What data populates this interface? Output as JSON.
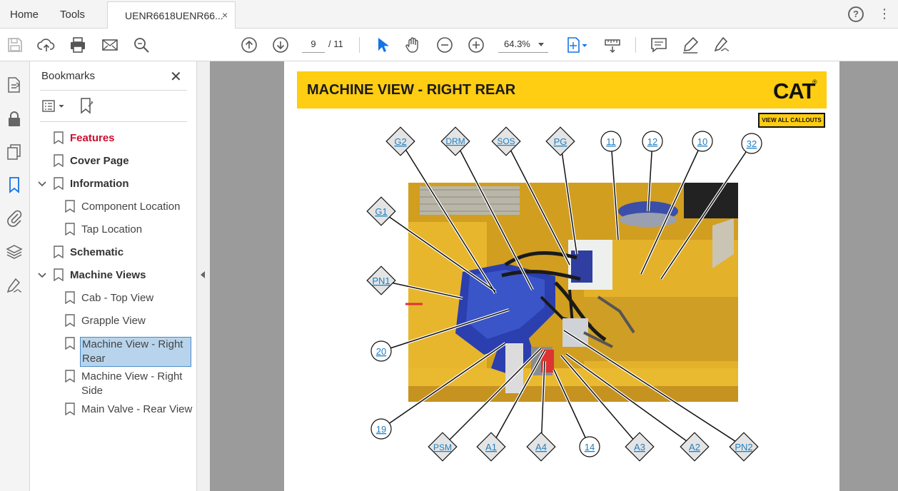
{
  "menubar": {
    "home": "Home",
    "tools": "Tools",
    "tab_title": "UENR6618UENR66...",
    "tab_close": "×",
    "help": "?"
  },
  "toolbar": {
    "page_current": "9",
    "page_total": "/ 11",
    "zoom": "64.3%"
  },
  "bookmarks": {
    "title": "Bookmarks",
    "items": [
      {
        "label": "Features"
      },
      {
        "label": "Cover Page"
      },
      {
        "label": "Information"
      },
      {
        "label": "Component Location"
      },
      {
        "label": "Tap Location"
      },
      {
        "label": "Schematic"
      },
      {
        "label": "Machine Views"
      },
      {
        "label": "Cab - Top View"
      },
      {
        "label": "Grapple View"
      },
      {
        "label": "Machine View - Right Rear"
      },
      {
        "label": "Machine View - Right Side"
      },
      {
        "label": "Main Valve - Rear View"
      }
    ]
  },
  "document": {
    "title": "MACHINE VIEW - RIGHT REAR",
    "logo": "CAT",
    "logo_mark": "®",
    "callouts_button": "VIEW ALL CALLOUTS",
    "callouts_top": [
      "G2",
      "DRM",
      "SOS",
      "PG",
      "11",
      "12",
      "10",
      "32"
    ],
    "callouts_left": [
      "G1",
      "PN1",
      "20",
      "19"
    ],
    "callouts_bottom": [
      "PSM",
      "A1",
      "A4",
      "14",
      "A3",
      "A2",
      "PN2"
    ]
  },
  "colors": {
    "cat_yellow": "#ffcd11",
    "link_blue": "#1f7fc2",
    "accent_blue": "#1473e6",
    "selection": "#b8d4ec"
  }
}
